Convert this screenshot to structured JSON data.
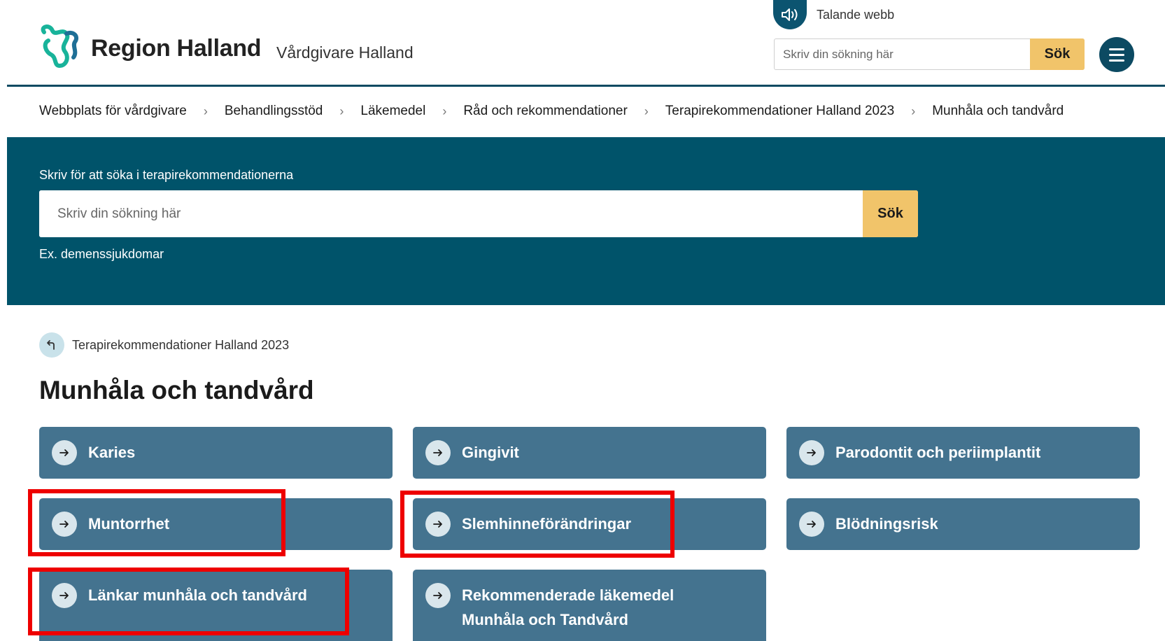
{
  "header": {
    "brand": "Region Halland",
    "subbrand": "Vårdgivare Halland",
    "talande_label": "Talande webb",
    "search_placeholder": "Skriv din sökning här",
    "search_button": "Sök",
    "menu_icon": "hamburger-menu-icon",
    "accent_color": "#0c4a62",
    "button_color": "#f1c46a"
  },
  "breadcrumb": [
    "Webbplats för vårdgivare",
    "Behandlingsstöd",
    "Läkemedel",
    "Råd och rekommendationer",
    "Terapirekommendationer Halland 2023",
    "Munhåla och tandvård"
  ],
  "search_band": {
    "label": "Skriv för att söka i terapirekommendationerna",
    "placeholder": "Skriv din sökning här",
    "button": "Sök",
    "example": "Ex. demenssjukdomar",
    "background": "#00536a"
  },
  "back_link": "Terapirekommendationer Halland 2023",
  "page_title": "Munhåla och tandvård",
  "cards": [
    "Karies",
    "Gingivit",
    "Parodontit och periimplantit",
    "Muntorrhet",
    "Slemhinneförändringar",
    "Blödningsrisk",
    "Länkar munhåla och tandvård",
    "Rekommenderade läkemedel Munhåla och Tandvård"
  ],
  "card_color": "#44738f",
  "highlight_color": "#ee0000"
}
